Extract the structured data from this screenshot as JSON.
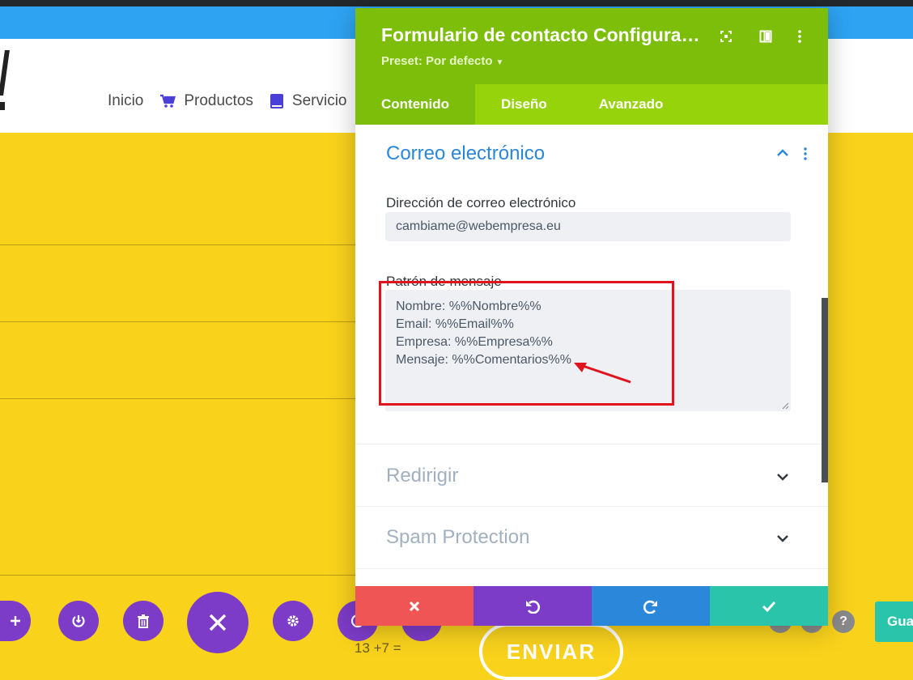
{
  "site": {
    "nav": [
      {
        "label": "Inicio",
        "icon": ""
      },
      {
        "label": "Productos",
        "icon": "cart-icon"
      },
      {
        "label": "Servicio",
        "icon": "book-icon"
      }
    ]
  },
  "builder": {
    "captcha_text": "13 +7 =",
    "submit_label": "ENVIAR",
    "help_label": "?",
    "save_label": "Gua"
  },
  "modal": {
    "title": "Formulario de contacto Configurac...",
    "preset": "Preset: Por defecto",
    "tabs": [
      {
        "label": "Contenido",
        "active": true
      },
      {
        "label": "Diseño",
        "active": false
      },
      {
        "label": "Avanzado",
        "active": false
      }
    ],
    "section_open": {
      "title": "Correo electrónico",
      "email_label": "Dirección de correo electrónico",
      "email_value": "cambiame@webempresa.eu",
      "pattern_label": "Patrón de mensaje",
      "pattern_lines": [
        "Nombre: %%Nombre%%",
        "Email: %%Email%%",
        "Empresa: %%Empresa%%",
        "Mensaje: %%Comentarios%%"
      ]
    },
    "sections_closed": [
      "Redirigir",
      "Spam Protection"
    ]
  },
  "colors": {
    "header_green": "#7cbe0a",
    "tabs_green": "#97d30a",
    "link_blue": "#2b87da",
    "cancel_red": "#ef5555",
    "undo_purple": "#7d3cc8",
    "redo_blue": "#2b87da",
    "save_teal": "#29c4a9",
    "page_yellow": "#f9d21c"
  }
}
